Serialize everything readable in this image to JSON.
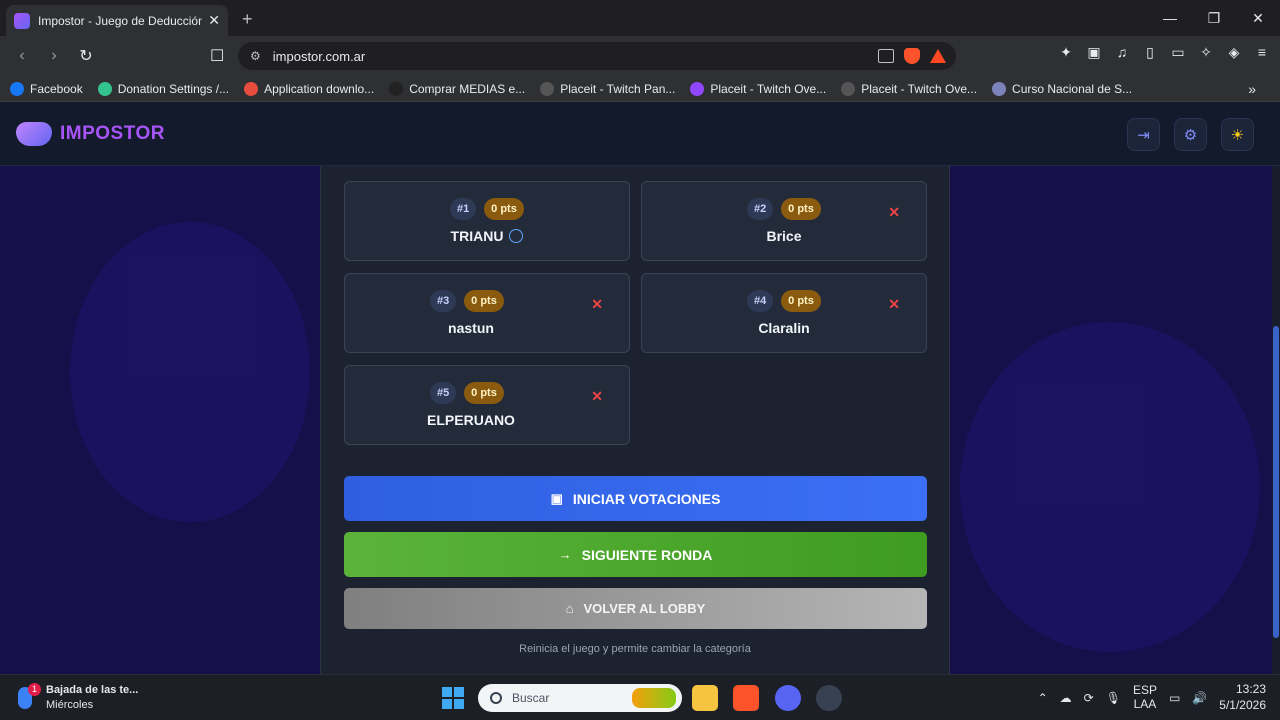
{
  "browser": {
    "tab_title": "Impostor - Juego de Deducción",
    "url": "impostor.com.ar",
    "bookmarks": [
      {
        "label": "Facebook",
        "color": "#1877f2"
      },
      {
        "label": "Donation Settings /...",
        "color": "#34c38f"
      },
      {
        "label": "Application downlo...",
        "color": "#e74c3c"
      },
      {
        "label": "Comprar MEDIAS e...",
        "color": "#222222"
      },
      {
        "label": "Placeit - Twitch Pan...",
        "color": "#555555"
      },
      {
        "label": "Placeit - Twitch Ove...",
        "color": "#9146ff"
      },
      {
        "label": "Placeit - Twitch Ove...",
        "color": "#555555"
      },
      {
        "label": "Curso Nacional de S...",
        "color": "#7c83b8"
      }
    ]
  },
  "app": {
    "logo_text": "IMPOSTOR",
    "accent": "#a855f7"
  },
  "players": [
    {
      "rank": "#1",
      "points": "0 pts",
      "name": "TRIANU",
      "host": true,
      "removable": false
    },
    {
      "rank": "#2",
      "points": "0 pts",
      "name": "Brice",
      "host": false,
      "removable": true
    },
    {
      "rank": "#3",
      "points": "0 pts",
      "name": "nastun",
      "host": false,
      "removable": true
    },
    {
      "rank": "#4",
      "points": "0 pts",
      "name": "Claralin",
      "host": false,
      "removable": true
    },
    {
      "rank": "#5",
      "points": "0 pts",
      "name": "ELPERUANO",
      "host": false,
      "removable": true
    }
  ],
  "actions": {
    "vote": "INICIAR VOTACIONES",
    "next": "SIGUIENTE RONDA",
    "lobby": "VOLVER AL LOBBY",
    "hint": "Reinicia el juego y permite cambiar la categoría"
  },
  "taskbar": {
    "weather_title": "Bajada de las te...",
    "weather_day": "Miércoles",
    "weather_badge": "1",
    "search_placeholder": "Buscar",
    "lang_top": "ESP",
    "lang_bottom": "LAA",
    "time": "13:23",
    "date": "5/1/2026"
  }
}
